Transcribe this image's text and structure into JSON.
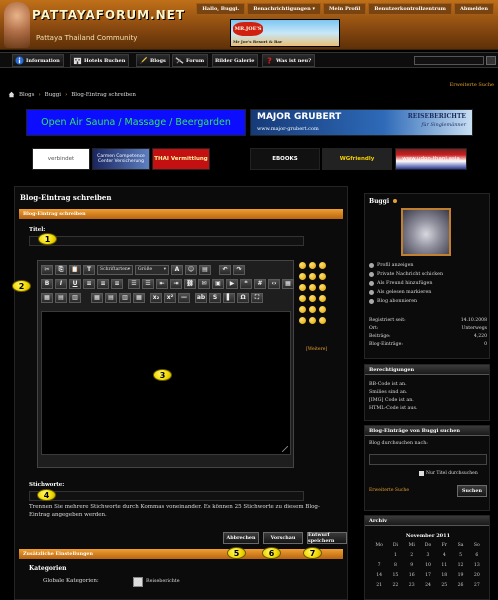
{
  "header": {
    "logo_text": "PATTAYAFORUM.NET",
    "logo_subtitle": "Pattaya Thailand Community",
    "nav": [
      "Hallo, Buggi.",
      "Benachrichtigungen ▾",
      "Mein Profil",
      "Benutzerkontrollzentrum",
      "Abmelden"
    ],
    "ad_logo": "MR.JOE'S",
    "ad_text": "Mr Joe's Resort & Bar"
  },
  "main_nav": {
    "tabs": [
      {
        "label": "Information",
        "icon": "info-icon"
      },
      {
        "label": "Hotels Buchen",
        "icon": "hotel-icon"
      },
      {
        "label": "Blogs",
        "icon": "blog-icon"
      },
      {
        "label": "Forum",
        "icon": "forum-icon"
      },
      {
        "label": "Bilder Galerie",
        "icon": "gallery-icon"
      },
      {
        "label": "Was ist neu?",
        "icon": "question-icon"
      }
    ],
    "advanced_search": "Erweiterte Suche"
  },
  "breadcrumb": [
    "Blogs",
    "Buggi",
    "Blog-Eintrag schreiben"
  ],
  "banners": {
    "sauna": "Open Air Sauna / Massage / Beergarden",
    "gruber_title": "MAJOR GRUBERT",
    "gruber_url": "www.major-grubert.com",
    "gruber_right": "REISEBERICHTE",
    "gruber_right2": "für Singlemänner",
    "small": [
      "verbindet",
      "Carmen Competence Center Versicherung",
      "THAI Vermittlung",
      "EBOOKS",
      "WGfriendly",
      "www.udon-thani.asia"
    ]
  },
  "editor_form": {
    "panel_title": "Blog-Eintrag schreiben",
    "section_bar": "Blog-Eintrag schreiben",
    "title_label": "Titel:",
    "title_value": "",
    "font_select": "Schriftarten",
    "size_select": "Größe",
    "more_smilies": "[Weitere]",
    "tags_label": "Stichworte:",
    "tags_value": "",
    "tags_help": "Trennen Sie mehrere Stichworte durch Kommas voneinander. Es können 25 Stichworte zu diesem Blog-Eintrag angegeben werden.",
    "buttons": {
      "abort": "Abbrechen",
      "preview": "Vorschau",
      "draft": "Entwurf speichern"
    },
    "additional_settings": "Zusätzliche Einstellungen",
    "categories_label": "Kategorien",
    "global_category_label": "Globale Kategorien:",
    "category_item": "Reiseberichte"
  },
  "markers": [
    "1",
    "2",
    "3",
    "4",
    "5",
    "6",
    "7"
  ],
  "sidebar": {
    "username": "Buggi",
    "profile_links": [
      "Profil anzeigen",
      "Private Nachricht schicken",
      "Als Freund hinzufügen",
      "Als gelesen markieren",
      "Blog abonnieren"
    ],
    "stats": [
      {
        "label": "Registriert seit:",
        "value": "14.10.2008"
      },
      {
        "label": "Ort:",
        "value": "Unterwegs"
      },
      {
        "label": "Beiträge:",
        "value": "4,220"
      },
      {
        "label": "Blog-Einträge:",
        "value": "0"
      }
    ],
    "permissions_title": "Berechtigungen",
    "permissions": [
      "BB-Code ist an.",
      "Smilies sind an.",
      "[IMG] Code ist an.",
      "HTML-Code ist aus."
    ],
    "search_title": "Blog-Einträge von Buggi suchen",
    "search_label": "Blog durchsuchen nach:",
    "title_only": "Nur Titel durchsuchen",
    "adv_search": "Erweiterte Suche",
    "search_button": "Suchen",
    "archive_title": "Archiv",
    "calendar_month": "November 2011",
    "weekdays": [
      "Mo",
      "Di",
      "Mi",
      "Do",
      "Fr",
      "Sa",
      "So"
    ],
    "days": [
      "",
      "1",
      "2",
      "3",
      "4",
      "5",
      "6",
      "7",
      "8",
      "9",
      "10",
      "11",
      "12",
      "13",
      "14",
      "15",
      "16",
      "17",
      "18",
      "19",
      "20",
      "21",
      "22",
      "23",
      "24",
      "25",
      "26",
      "27"
    ]
  },
  "colors": {
    "accent": "#e8a030",
    "marker": "#f1d800",
    "background": "#000000"
  }
}
